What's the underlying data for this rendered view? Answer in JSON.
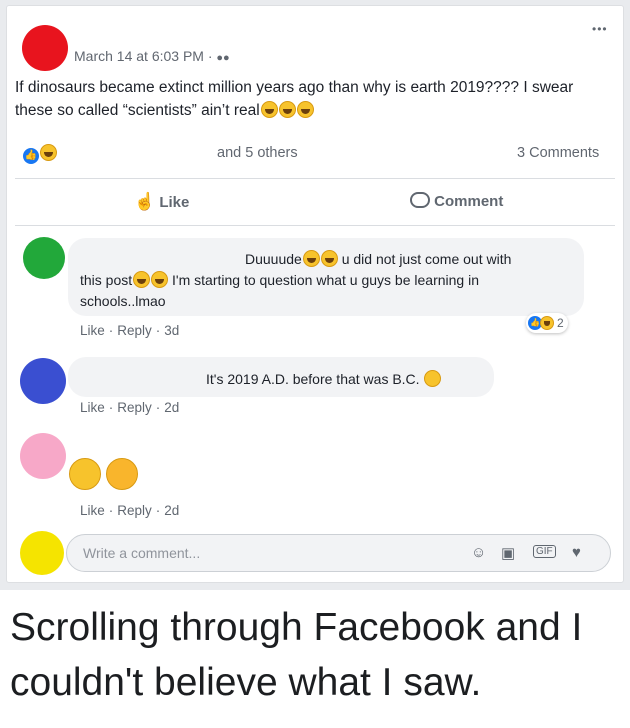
{
  "post": {
    "timestamp": "March 14 at 6:03 PM",
    "separator": "·",
    "text": "If dinosaurs became extinct million years ago than why is earth 2019???? I swear these so called “scientists” ain’t real",
    "reactions_text": "and 5 others",
    "comments_count": "3 Comments",
    "like_label": "Like",
    "comment_label": "Comment",
    "more_label": "•••"
  },
  "comments": [
    {
      "avatar_color": "#22a83a",
      "line1": "Duuuude",
      "line1b": "u did not just come out with",
      "line2a": "this post",
      "line2b": "I'm starting to question what u guys be learning in",
      "line3": "schools..lmao",
      "like": "Like",
      "reply": "Reply",
      "time": "3d",
      "reactions_count": "2"
    },
    {
      "avatar_color": "#3a4fd1",
      "text": "It's 2019 A.D. before that was B.C.",
      "like": "Like",
      "reply": "Reply",
      "time": "2d"
    },
    {
      "avatar_color": "#f7a8c8",
      "like": "Like",
      "reply": "Reply",
      "time": "2d"
    }
  ],
  "composer": {
    "avatar_color": "#f5e400",
    "placeholder": "Write a comment...",
    "gif_label": "GIF"
  },
  "post_avatar_color": "#e8141e",
  "caption": "Scrolling through Facebook and I couldn't believe what I saw."
}
